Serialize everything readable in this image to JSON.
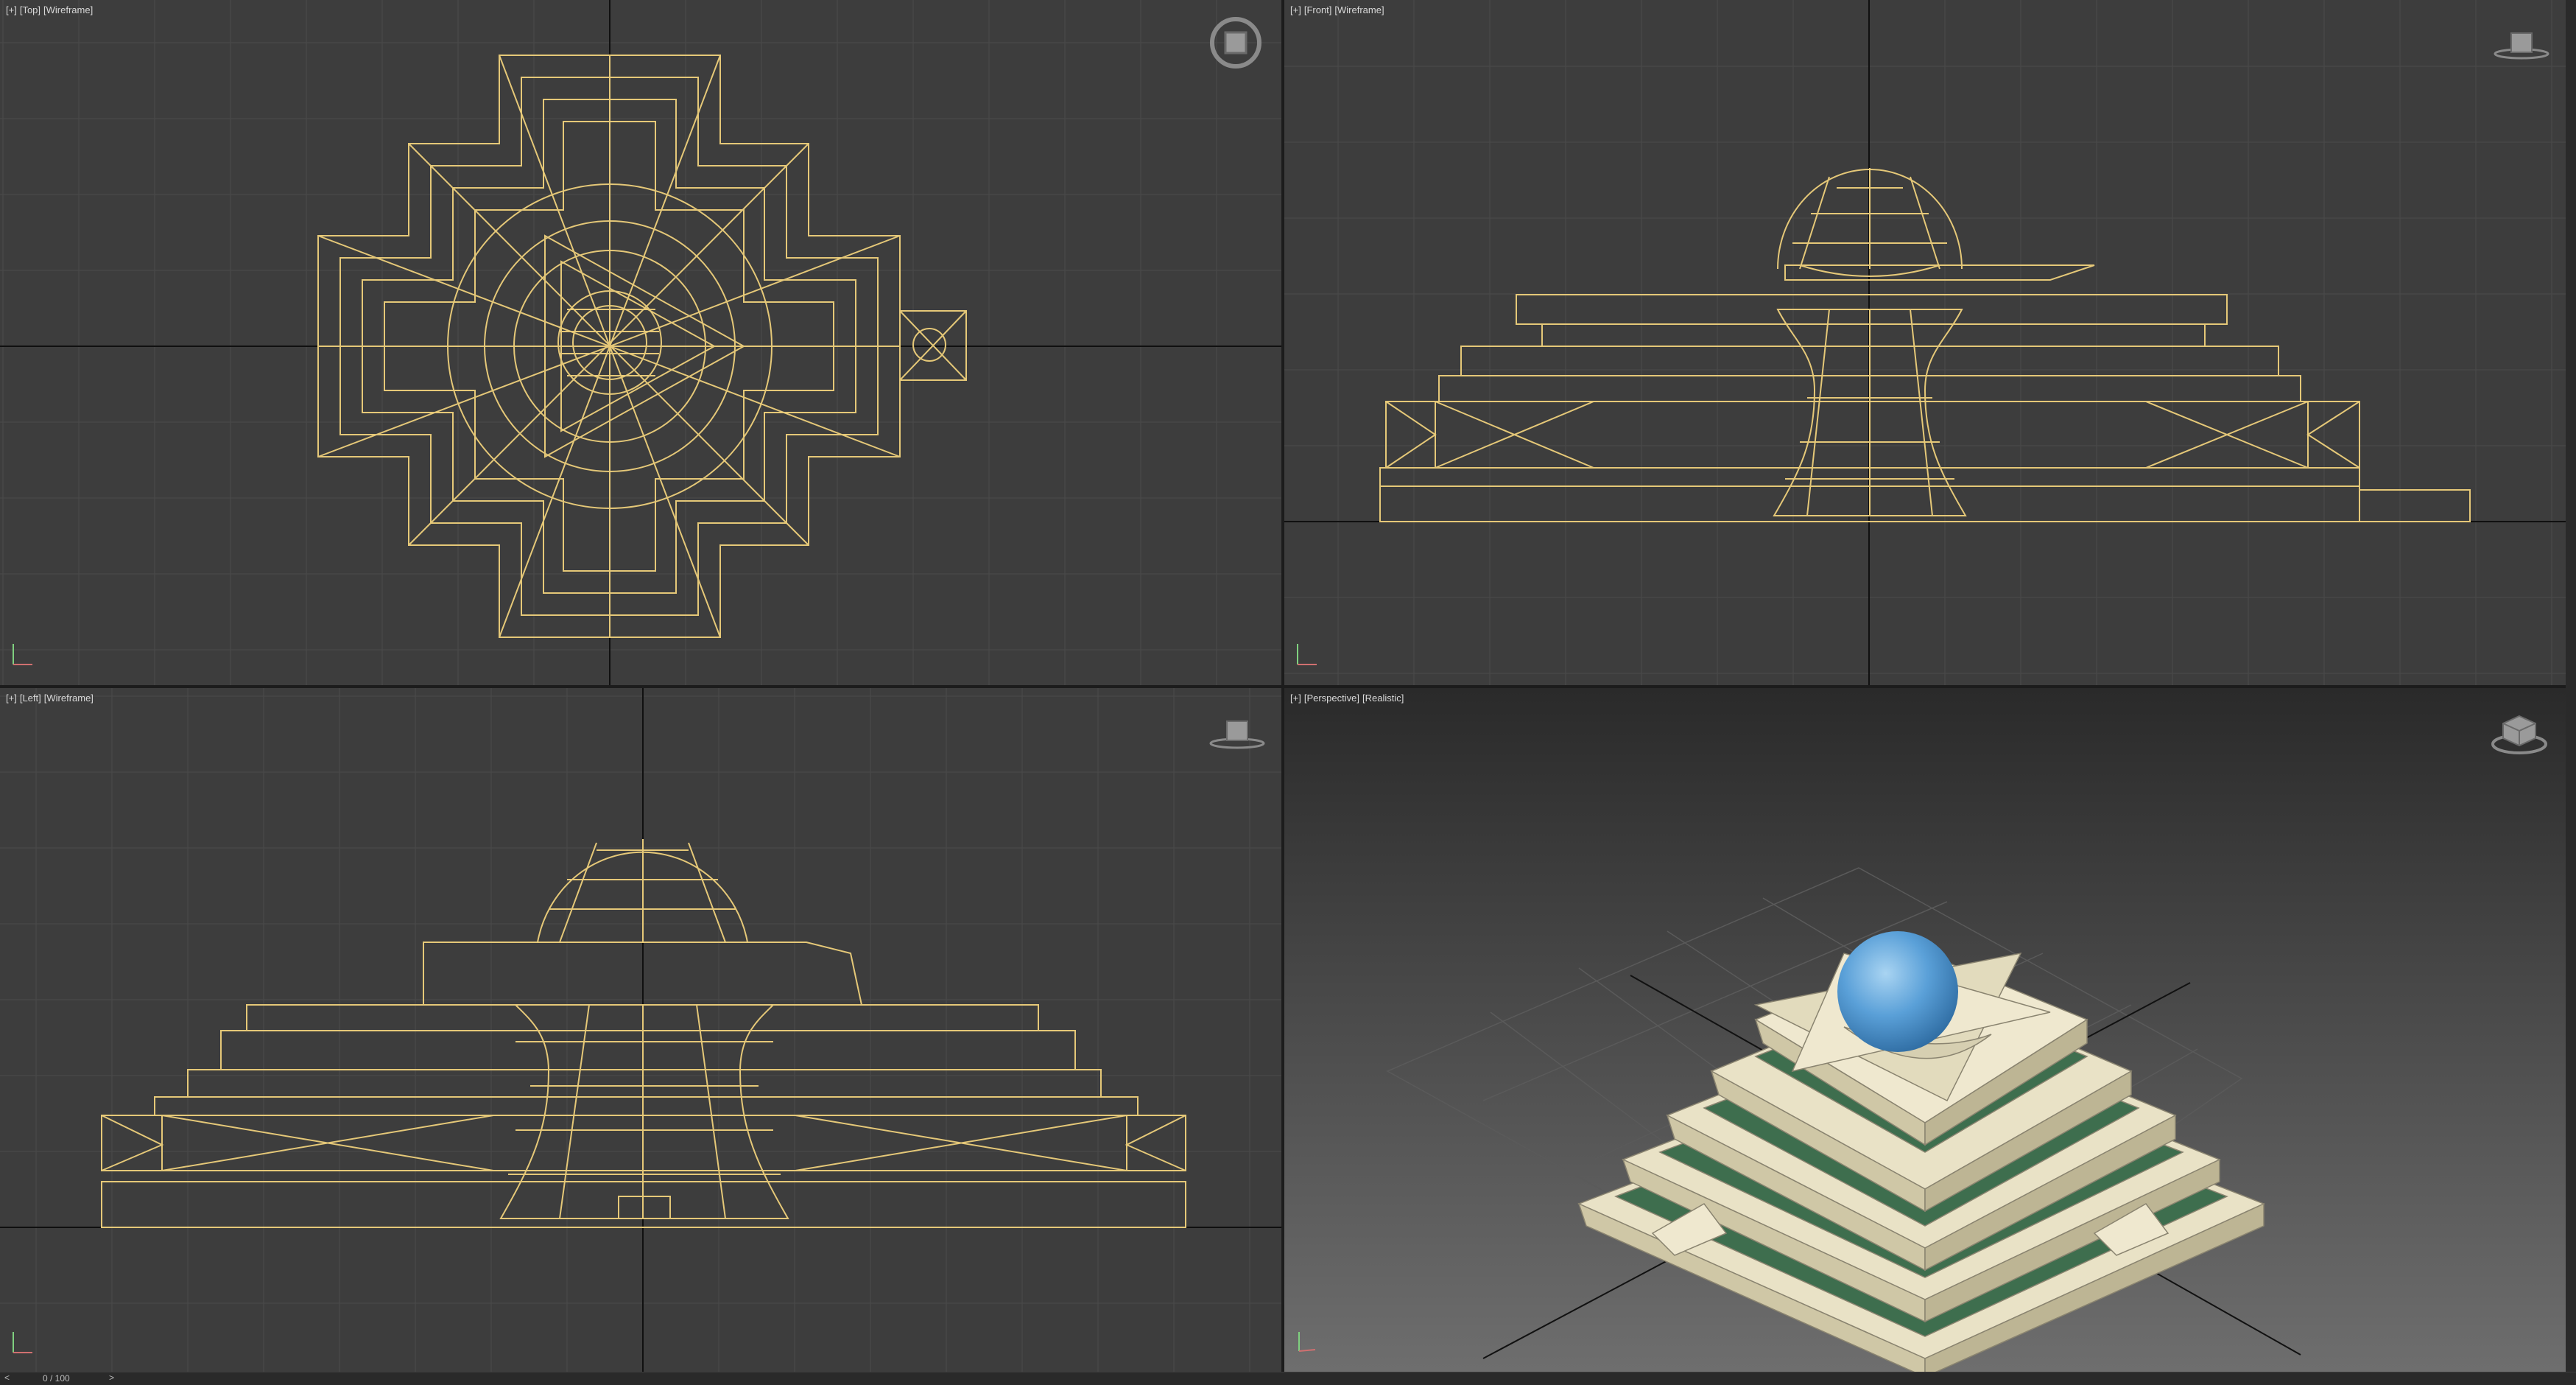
{
  "viewports": {
    "top": {
      "plus": "[+]",
      "view": "[Top]",
      "shading": "[Wireframe]"
    },
    "front": {
      "plus": "[+]",
      "view": "[Front]",
      "shading": "[Wireframe]"
    },
    "left": {
      "plus": "[+]",
      "view": "[Left]",
      "shading": "[Wireframe]"
    },
    "perspective": {
      "plus": "[+]",
      "view": "[Perspective]",
      "shading": "[Realistic]"
    }
  },
  "timeline": {
    "frame": "0 / 100",
    "prev": "<",
    "next": ">"
  },
  "colors": {
    "wire": "#e5c878",
    "viewport_bg": "#3d3d3d",
    "grid": "#4a4a4a",
    "grid_major": "#101010",
    "active_border": "#a8925a",
    "sphere": "#5aa0d8",
    "cream": "#efe8cf",
    "green": "#3e6e4e"
  },
  "icons": [
    "viewcube-top-icon",
    "viewcube-front-icon",
    "viewcube-left-icon",
    "viewcube-perspective-icon",
    "axis-tripod-icon"
  ]
}
